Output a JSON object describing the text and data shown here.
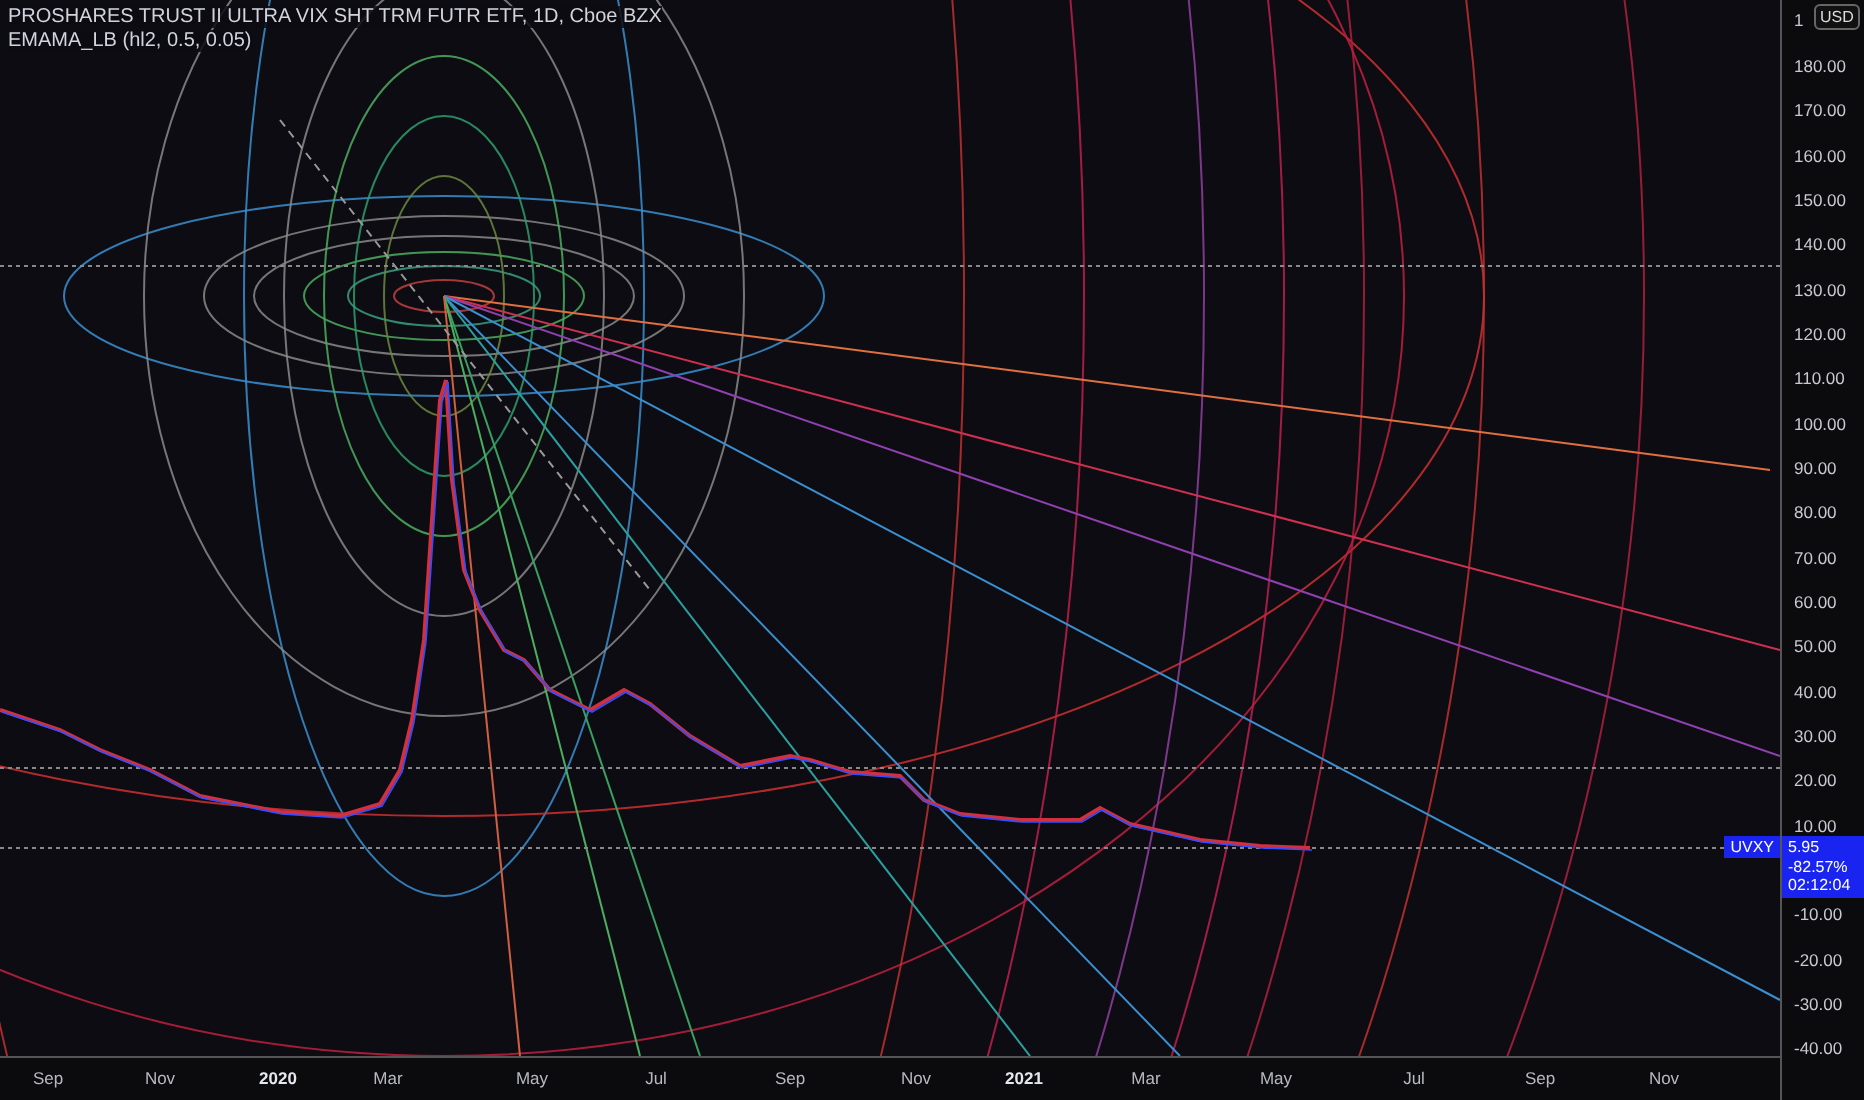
{
  "header": {
    "symbol_title": "PROSHARES TRUST II ULTRA VIX SHT TRM FUTR ETF, 1D, Cboe BZX",
    "indicator": "EMAMA_LB (hl2, 0.5, 0.05)"
  },
  "price_axis": {
    "top_tick": "1",
    "currency": "USD",
    "ticks": [
      "180.00",
      "170.00",
      "160.00",
      "150.00",
      "140.00",
      "130.00",
      "120.00",
      "110.00",
      "100.00",
      "90.00",
      "80.00",
      "70.00",
      "60.00",
      "50.00",
      "40.00",
      "30.00",
      "20.00",
      "10.00",
      "-10.00",
      "-20.00",
      "-30.00",
      "-40.00"
    ]
  },
  "last_price": {
    "symbol": "UVXY",
    "price": "5.95",
    "change": "-82.57%",
    "countdown": "02:12:04"
  },
  "time_axis": {
    "ticks": [
      {
        "label": "Sep",
        "kind": "month"
      },
      {
        "label": "Nov",
        "kind": "month"
      },
      {
        "label": "2020",
        "kind": "year"
      },
      {
        "label": "Mar",
        "kind": "month"
      },
      {
        "label": "May",
        "kind": "month"
      },
      {
        "label": "Jul",
        "kind": "month"
      },
      {
        "label": "Sep",
        "kind": "month"
      },
      {
        "label": "Nov",
        "kind": "month"
      },
      {
        "label": "2021",
        "kind": "year"
      },
      {
        "label": "Mar",
        "kind": "month"
      },
      {
        "label": "May",
        "kind": "month"
      },
      {
        "label": "Jul",
        "kind": "month"
      },
      {
        "label": "Sep",
        "kind": "month"
      },
      {
        "label": "Nov",
        "kind": "month"
      }
    ]
  }
}
